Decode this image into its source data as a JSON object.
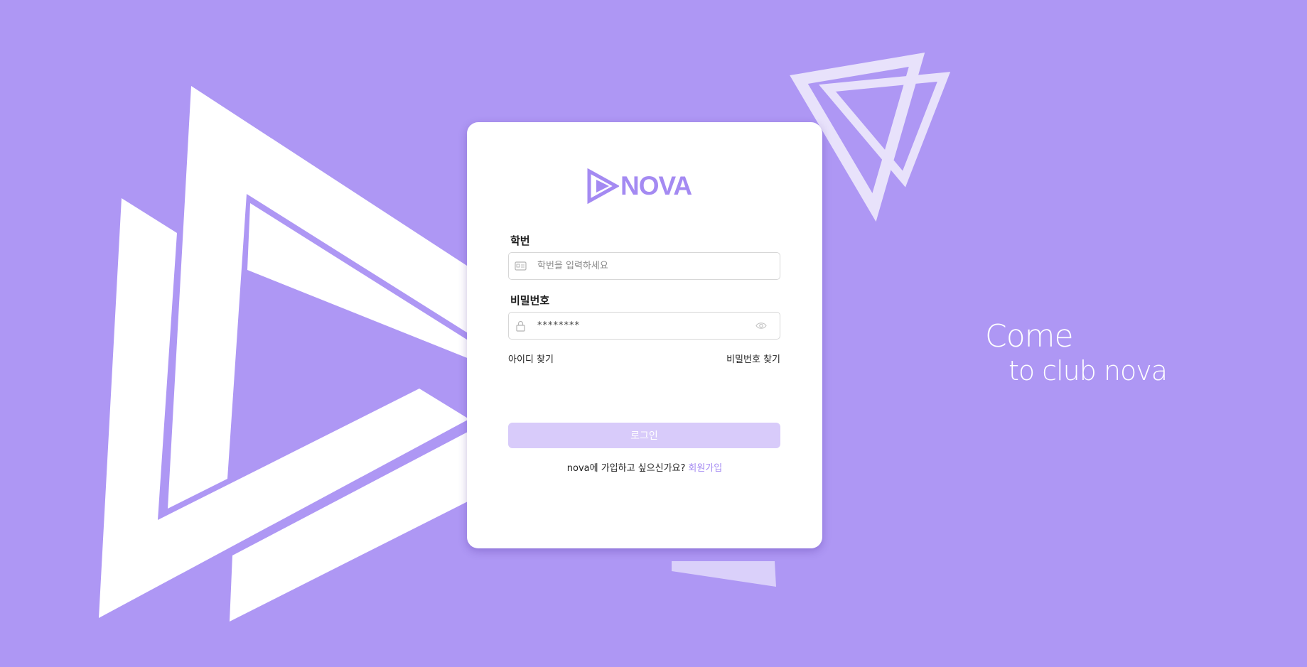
{
  "brand": {
    "name": "NOVA",
    "color": "#a48af2",
    "background": "#ae97f4"
  },
  "login_form": {
    "student_id": {
      "label": "학번",
      "placeholder": "학번을 입력하세요",
      "icon": "id-card-icon"
    },
    "password": {
      "label": "비밀번호",
      "value": "********",
      "icon": "lock-icon",
      "toggle_icon": "eye-icon"
    },
    "find_id_link": "아이디 찾기",
    "find_password_link": "비밀번호 찾기",
    "login_button": "로그인",
    "signup_prompt": "nova에 가입하고 싶으신가요?",
    "signup_link": "회원가입"
  },
  "tagline": {
    "line1": "Come",
    "line2": "to club nova"
  }
}
